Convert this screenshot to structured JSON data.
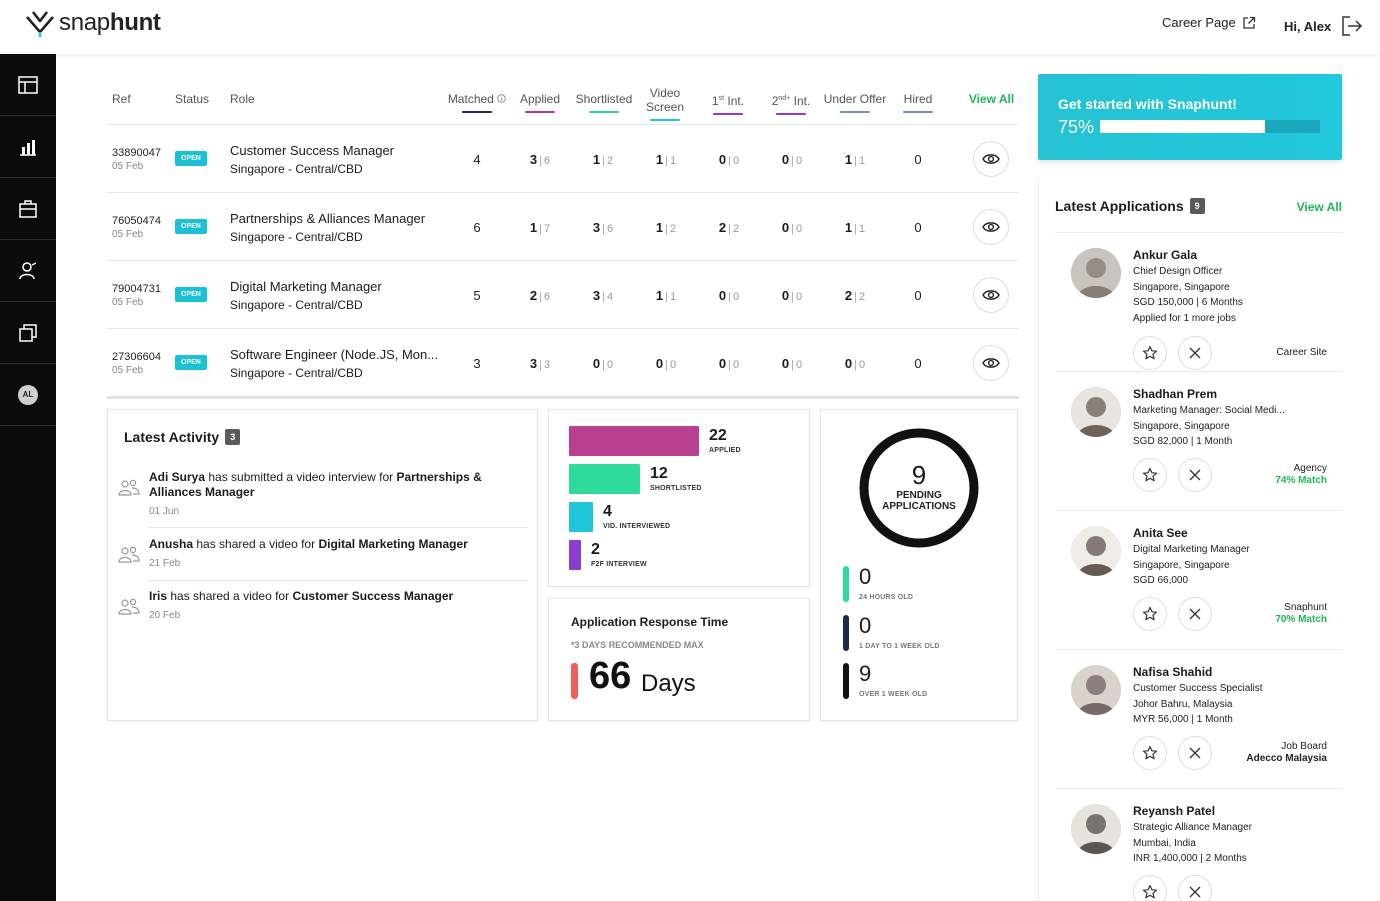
{
  "header": {
    "logo_text_light": "snap",
    "logo_text_bold": "hunt",
    "career_page": "Career Page",
    "greeting": "Hi, Alex"
  },
  "sidebar": {
    "icons": [
      "dashboard-icon",
      "analytics-icon",
      "briefcase-icon",
      "candidates-icon",
      "templates-icon"
    ],
    "avatar_initials": "AL"
  },
  "jobs": {
    "headers": {
      "ref": "Ref",
      "status": "Status",
      "role": "Role",
      "matched": "Matched",
      "applied": "Applied",
      "shortlisted": "Shortlisted",
      "video_screen_1": "Video",
      "video_screen_2": "Screen",
      "first_int_num": "1",
      "first_int_sup": "st",
      "first_int_txt": "Int.",
      "second_int_num": "2",
      "second_int_sup": "nd+",
      "second_int_txt": "Int.",
      "under_offer": "Under Offer",
      "hired": "Hired",
      "view_all": "View All"
    },
    "underline_colors": {
      "matched": "#1e2a4a",
      "applied": "#c2348a",
      "shortlisted": "#27d6a2",
      "video": "#1ec6d8",
      "first": "#8a3dd1",
      "second": "#8a3dd1",
      "offer": "#6c8fe8",
      "hired": "#6c8fe8"
    },
    "rows": [
      {
        "ref": "33890047",
        "date": "05 Feb",
        "status": "OPEN",
        "title": "Customer Success Manager",
        "location": "Singapore - Central/CBD",
        "matched": "4",
        "applied": [
          "3",
          "6"
        ],
        "shortlisted": [
          "1",
          "2"
        ],
        "video": [
          "1",
          "1"
        ],
        "first": [
          "0",
          "0"
        ],
        "second": [
          "0",
          "0"
        ],
        "offer": [
          "1",
          "1"
        ],
        "hired": "0"
      },
      {
        "ref": "76050474",
        "date": "05 Feb",
        "status": "OPEN",
        "title": "Partnerships & Alliances Manager",
        "location": "Singapore - Central/CBD",
        "matched": "6",
        "applied": [
          "1",
          "7"
        ],
        "shortlisted": [
          "3",
          "6"
        ],
        "video": [
          "1",
          "2"
        ],
        "first": [
          "2",
          "2"
        ],
        "second": [
          "0",
          "0"
        ],
        "offer": [
          "1",
          "1"
        ],
        "hired": "0"
      },
      {
        "ref": "79004731",
        "date": "05 Feb",
        "status": "OPEN",
        "title": "Digital Marketing Manager",
        "location": "Singapore - Central/CBD",
        "matched": "5",
        "applied": [
          "2",
          "6"
        ],
        "shortlisted": [
          "3",
          "4"
        ],
        "video": [
          "1",
          "1"
        ],
        "first": [
          "0",
          "0"
        ],
        "second": [
          "0",
          "0"
        ],
        "offer": [
          "2",
          "2"
        ],
        "hired": "0"
      },
      {
        "ref": "27306604",
        "date": "05 Feb",
        "status": "OPEN",
        "title": "Software Engineer (Node.JS, Mon...",
        "location": "Singapore - Central/CBD",
        "matched": "3",
        "applied": [
          "3",
          "3"
        ],
        "shortlisted": [
          "0",
          "0"
        ],
        "video": [
          "0",
          "0"
        ],
        "first": [
          "0",
          "0"
        ],
        "second": [
          "0",
          "0"
        ],
        "offer": [
          "0",
          "0"
        ],
        "hired": "0"
      }
    ]
  },
  "activity": {
    "title": "Latest Activity",
    "count": "3",
    "items": [
      {
        "pre": "Adi Surya",
        "mid": " has submitted a video interview for ",
        "post": "Partnerships & Alliances Manager",
        "date": "01 Jun"
      },
      {
        "pre": "Anusha",
        "mid": " has shared a video for ",
        "post": "Digital Marketing Manager",
        "date": "21 Feb"
      },
      {
        "pre": "Iris",
        "mid": " has shared a video for ",
        "post": "Customer Success Manager",
        "date": "20 Feb"
      }
    ]
  },
  "funnel": [
    {
      "value": 22,
      "label": "APPLIED",
      "color": "#b8408f"
    },
    {
      "value": 12,
      "label": "SHORTLISTED",
      "color": "#2edb9a"
    },
    {
      "value": 4,
      "label": "VID. INTERVIEWED",
      "color": "#1ec6d8"
    },
    {
      "value": 2,
      "label": "F2F INTERVIEW",
      "color": "#8a3dd1"
    }
  ],
  "response_time": {
    "title": "Application Response Time",
    "note": "*3 DAYS RECOMMENDED MAX",
    "value": "66",
    "unit": "Days",
    "bar_color": "#f0605a"
  },
  "pending": {
    "value": "9",
    "label_1": "PENDING",
    "label_2": "APPLICATIONS",
    "aging": [
      {
        "value": "0",
        "label": "24 HOURS OLD",
        "color": "#2edb9a"
      },
      {
        "value": "0",
        "label": "1 DAY TO 1 WEEK OLD",
        "color": "#1e2a4a"
      },
      {
        "value": "9",
        "label": "OVER 1 WEEK OLD",
        "color": "#111111"
      }
    ]
  },
  "cta": {
    "title": "Get started with Snaphunt!",
    "percent_label": "75%",
    "progress": 0.75
  },
  "applications": {
    "title": "Latest Applications",
    "count": "9",
    "view_all": "View All",
    "items": [
      {
        "name": "Ankur Gala",
        "role": "Chief Design Officer",
        "location": "Singapore, Singapore",
        "salary": "SGD 150,000 | 6 Months",
        "extra": "Applied for 1 more jobs",
        "source": "Career Site",
        "source_2": "",
        "match": ""
      },
      {
        "name": "Shadhan Prem",
        "role": "Marketing Manager: Social Medi...",
        "location": "Singapore, Singapore",
        "salary": "SGD 82,000 | 1 Month",
        "extra": "",
        "source": "Agency",
        "source_2": "",
        "match": "74% Match"
      },
      {
        "name": "Anita See",
        "role": "Digital Marketing Manager",
        "location": "Singapore, Singapore",
        "salary": "SGD 66,000",
        "extra": "",
        "source": "Snaphunt",
        "source_2": "",
        "match": "70% Match"
      },
      {
        "name": "Nafisa Shahid",
        "role": "Customer Success Specialist",
        "location": "Johor Bahru, Malaysia",
        "salary": "MYR 56,000 | 1 Month",
        "extra": "",
        "source": "Job Board",
        "source_2": "Adecco Malaysia",
        "match": ""
      },
      {
        "name": "Reyansh Patel",
        "role": "Strategic Alliance Manager",
        "location": "Mumbai, India",
        "salary": "INR 1,400,000 | 2 Months",
        "extra": "",
        "source": "",
        "source_2": "",
        "match": ""
      }
    ]
  }
}
